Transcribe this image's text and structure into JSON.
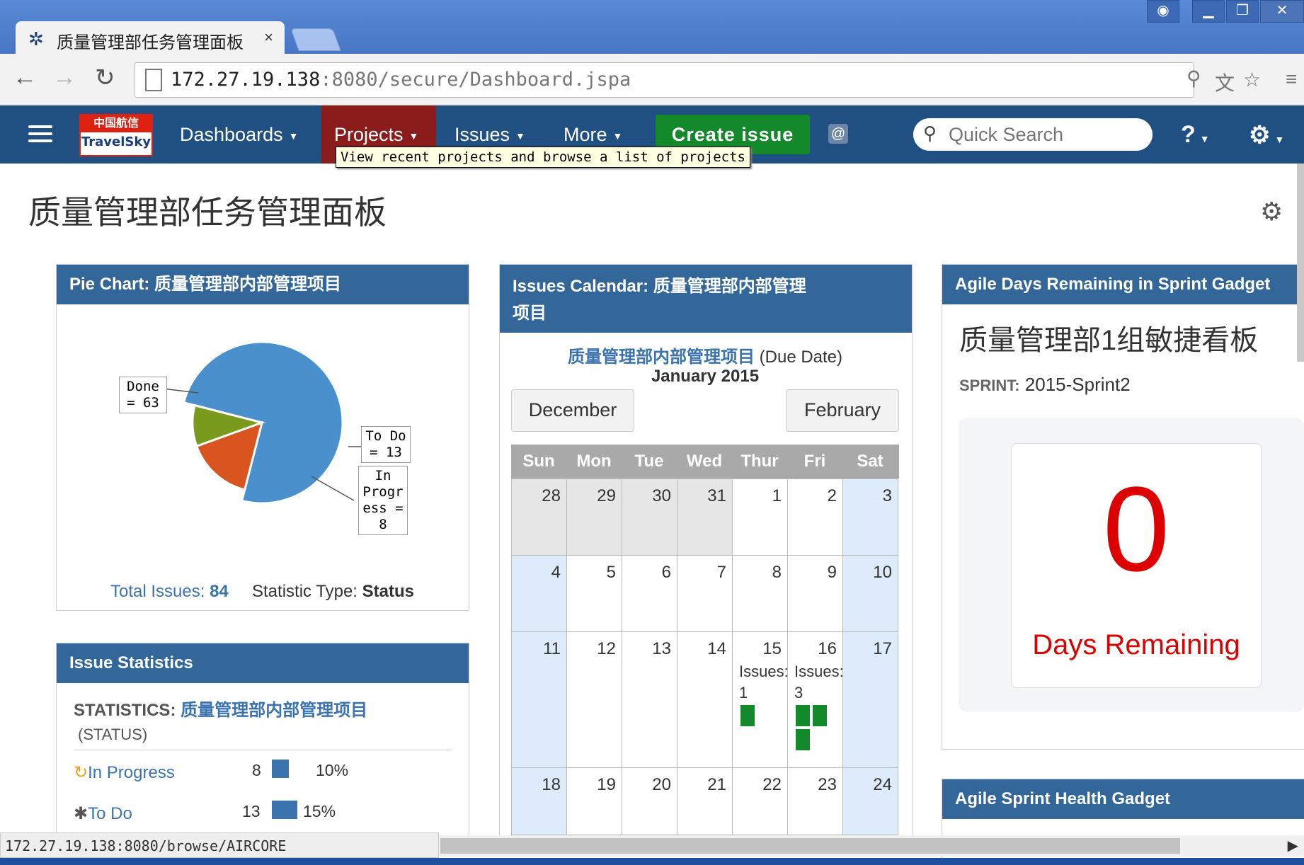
{
  "browser": {
    "tab_title": "质量管理部任务管理面板",
    "tab_close": "×",
    "url_host": "172.27.19.138",
    "url_rest": ":8080/secure/Dashboard.jspa",
    "status_url": "172.27.19.138:8080/browse/AIRCORE"
  },
  "header": {
    "logo_top": "中国航信",
    "logo_bottom": "TravelSky",
    "menu": [
      "Dashboards",
      "Projects",
      "Issues",
      "More"
    ],
    "create_label": "Create issue",
    "search_placeholder": "Quick Search",
    "tooltip": "View recent projects and browse a list of projects",
    "colors": {
      "bar": "#205081",
      "active": "#8b1c1c",
      "create": "#14892c"
    }
  },
  "page": {
    "title": "质量管理部任务管理面板"
  },
  "pie_gadget": {
    "title": "Pie Chart: 质量管理部内部管理项目",
    "total_label": "Total Issues:",
    "total_value": "84",
    "stat_label": "Statistic Type:",
    "stat_value": "Status"
  },
  "chart_data": {
    "type": "pie",
    "slices": [
      {
        "label": "Done",
        "value": 63,
        "color": "#4a90cc"
      },
      {
        "label": "To Do",
        "value": 13,
        "color": "#d9541e"
      },
      {
        "label": "In Progress",
        "value": 8,
        "color": "#7a9a1e"
      }
    ],
    "label_lines": [
      [
        "Done",
        "= 63"
      ],
      [
        "To Do",
        "= 13"
      ],
      [
        "In",
        "Progr",
        "ess =",
        "8"
      ]
    ]
  },
  "stats_gadget": {
    "title": "Issue Statistics",
    "stat_prefix": "STATISTICS:",
    "project": "质量管理部内部管理项目",
    "type": "(STATUS)",
    "rows": [
      {
        "label": "In Progress",
        "count": "8",
        "pct": "10%",
        "pct_value": 10
      },
      {
        "label": "To Do",
        "count": "13",
        "pct": "15%",
        "pct_value": 15
      }
    ]
  },
  "calendar": {
    "title_line1": "Issues Calendar: 质量管理部内部管理",
    "title_line2": "项目",
    "project": "质量管理部内部管理项目",
    "field": "(Due Date)",
    "month": "January 2015",
    "prev": "December",
    "next": "February",
    "days": [
      "Sun",
      "Mon",
      "Tue",
      "Wed",
      "Thur",
      "Fri",
      "Sat"
    ],
    "weeks": [
      [
        "28",
        "29",
        "30",
        "31",
        "1",
        "2",
        "3"
      ],
      [
        "4",
        "5",
        "6",
        "7",
        "8",
        "9",
        "10"
      ],
      [
        "11",
        "12",
        "13",
        "14",
        "15",
        "16",
        "17"
      ],
      [
        "18",
        "19",
        "20",
        "21",
        "22",
        "23",
        "24"
      ]
    ],
    "issues_label": "Issues:",
    "issue_15": "1",
    "issue_16": "3"
  },
  "agile": {
    "title": "Agile Days Remaining in Sprint Gadget",
    "board": "质量管理部1组敏捷看板",
    "sprint_label": "SPRINT:",
    "sprint_value": "2015-Sprint2",
    "days_value": "0",
    "days_label": "Days Remaining",
    "health_title": "Agile Sprint Health Gadget"
  }
}
